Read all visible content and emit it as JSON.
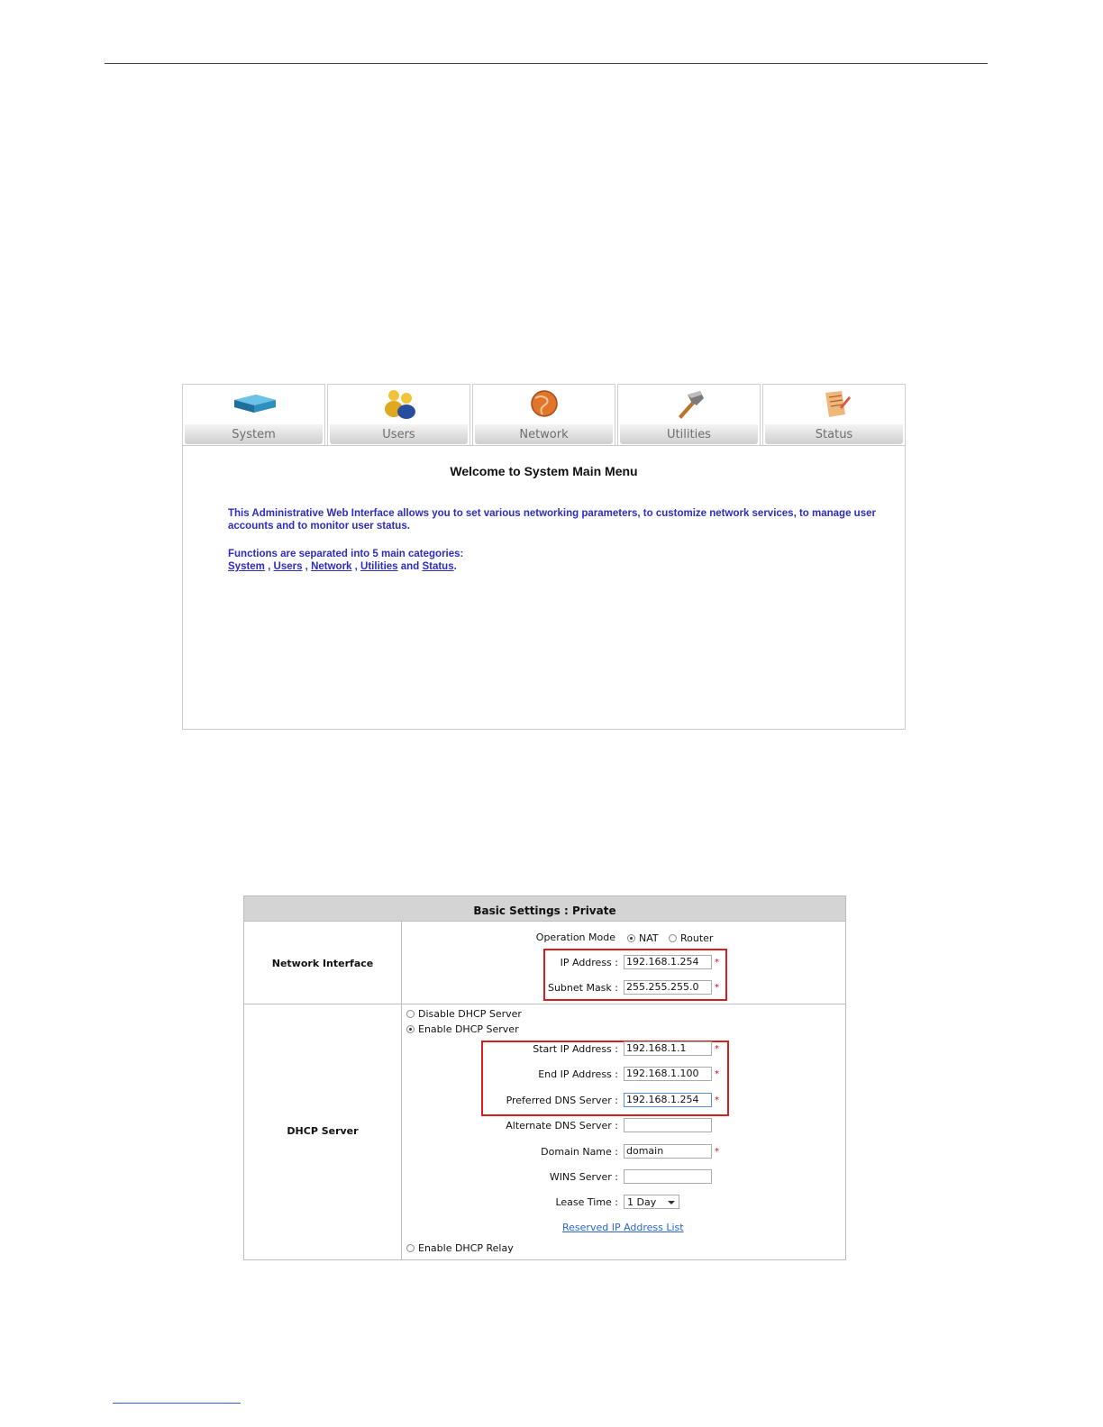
{
  "menu": {
    "tabs": [
      {
        "label": "System",
        "icon": "router-icon"
      },
      {
        "label": "Users",
        "icon": "users-icon"
      },
      {
        "label": "Network",
        "icon": "globe-icon"
      },
      {
        "label": "Utilities",
        "icon": "hammer-icon"
      },
      {
        "label": "Status",
        "icon": "notepad-icon"
      }
    ],
    "title": "Welcome to System Main Menu",
    "intro": "This Administrative Web Interface allows you to set various networking parameters, to customize network services, to manage user accounts and to monitor user status.",
    "functions_text": "Functions are separated into 5 main categories:",
    "links": [
      "System",
      "Users",
      "Network",
      "Utilities",
      "Status"
    ],
    "sep_comma": " , ",
    "sep_and": " and ",
    "end_period": "."
  },
  "settings": {
    "header": "Basic Settings : Private",
    "network_interface": {
      "label": "Network Interface",
      "operation_mode_label": "Operation Mode",
      "mode_options": [
        "NAT",
        "Router"
      ],
      "mode_selected": "NAT",
      "ip_label": "IP Address :",
      "ip_value": "192.168.1.254",
      "mask_label": "Subnet Mask :",
      "mask_value": "255.255.255.0"
    },
    "dhcp": {
      "label": "DHCP Server",
      "disable_label": "Disable DHCP Server",
      "enable_label": "Enable DHCP Server",
      "relay_label": "Enable DHCP Relay",
      "selected": "Enable DHCP Server",
      "start_label": "Start IP Address :",
      "start_value": "192.168.1.1",
      "end_label": "End IP Address :",
      "end_value": "192.168.1.100",
      "pref_dns_label": "Preferred DNS Server :",
      "pref_dns_value": "192.168.1.254",
      "alt_dns_label": "Alternate DNS Server :",
      "alt_dns_value": "",
      "domain_label": "Domain Name :",
      "domain_value": "domain",
      "wins_label": "WINS Server :",
      "wins_value": "",
      "lease_label": "Lease Time :",
      "lease_value": "1 Day",
      "reserved_link": "Reserved IP Address List"
    },
    "required_mark": "*",
    "highlight_color": "#d42020"
  }
}
